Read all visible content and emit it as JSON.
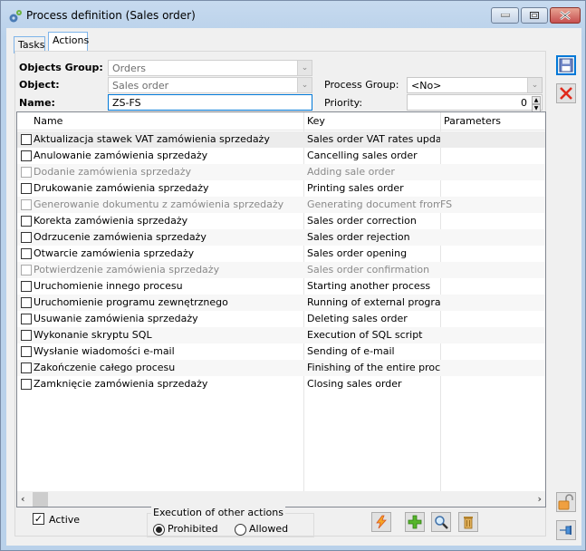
{
  "window": {
    "title": "Process definition (Sales order)",
    "controls": {
      "minimize": "minimize",
      "maximize": "maximize",
      "close": "close"
    }
  },
  "tabs": [
    {
      "label": "Tasks",
      "active": false
    },
    {
      "label": "Actions",
      "active": true
    }
  ],
  "form": {
    "objects_group_label": "Objects Group:",
    "objects_group_value": "Orders",
    "object_label": "Object:",
    "object_value": "Sales order",
    "name_label": "Name:",
    "name_value": "ZS-FS",
    "process_group_label": "Process Group:",
    "process_group_value": "<No>",
    "priority_label": "Priority:",
    "priority_value": "0"
  },
  "grid": {
    "columns": [
      "Name",
      "Key",
      "Parameters"
    ],
    "rows": [
      {
        "name": "Aktualizacja stawek VAT zamówienia sprzedaży",
        "key": "Sales order VAT rates update",
        "params": "",
        "checked": false,
        "enabled": true
      },
      {
        "name": "Anulowanie zamówienia sprzedaży",
        "key": "Cancelling sales order",
        "params": "",
        "checked": false,
        "enabled": true
      },
      {
        "name": "Dodanie zamówienia sprzedaży",
        "key": "Adding sale order",
        "params": "",
        "checked": false,
        "enabled": false
      },
      {
        "name": "Drukowanie zamówienia sprzedaży",
        "key": "Printing sales order",
        "params": "",
        "checked": false,
        "enabled": true
      },
      {
        "name": "Generowanie dokumentu z zamówienia sprzedaży",
        "key": "Generating document from sale",
        "params": "FS",
        "checked": false,
        "enabled": false
      },
      {
        "name": "Korekta zamówienia sprzedaży",
        "key": "Sales order correction",
        "params": "",
        "checked": false,
        "enabled": true
      },
      {
        "name": "Odrzucenie zamówienia sprzedaży",
        "key": "Sales order rejection",
        "params": "",
        "checked": false,
        "enabled": true
      },
      {
        "name": "Otwarcie zamówienia sprzedaży",
        "key": "Sales order opening",
        "params": "",
        "checked": false,
        "enabled": true
      },
      {
        "name": "Potwierdzenie zamówienia sprzedaży",
        "key": "Sales order confirmation",
        "params": "",
        "checked": false,
        "enabled": false
      },
      {
        "name": "Uruchomienie innego procesu",
        "key": "Starting another process",
        "params": "",
        "checked": false,
        "enabled": true
      },
      {
        "name": "Uruchomienie programu zewnętrznego",
        "key": "Running of external program",
        "params": "",
        "checked": false,
        "enabled": true
      },
      {
        "name": "Usuwanie zamówienia sprzedaży",
        "key": "Deleting sales order",
        "params": "",
        "checked": false,
        "enabled": true
      },
      {
        "name": "Wykonanie skryptu SQL",
        "key": "Execution of SQL script",
        "params": "",
        "checked": false,
        "enabled": true
      },
      {
        "name": "Wysłanie wiadomości e-mail",
        "key": "Sending of e-mail",
        "params": "",
        "checked": false,
        "enabled": true
      },
      {
        "name": "Zakończenie całego procesu",
        "key": "Finishing of the entire process",
        "params": "",
        "checked": false,
        "enabled": true
      },
      {
        "name": "Zamknięcie zamówienia sprzedaży",
        "key": "Closing sales order",
        "params": "",
        "checked": false,
        "enabled": true
      }
    ]
  },
  "footer": {
    "active_label": "Active",
    "active_checked": true,
    "execution_group_title": "Execution of other actions",
    "radio_prohibited": "Prohibited",
    "radio_allowed": "Allowed",
    "selected": "Prohibited"
  },
  "toolbar_icons": [
    "lightning-icon",
    "add-icon",
    "search-icon",
    "trash-icon"
  ],
  "sidebar_icons": [
    "save-icon",
    "cancel-icon",
    "lock-icon",
    "pin-icon"
  ],
  "colors": {
    "accent": "#0078d7",
    "window_frame": "#b9d1ea",
    "dim_text": "#8a8a8a"
  }
}
